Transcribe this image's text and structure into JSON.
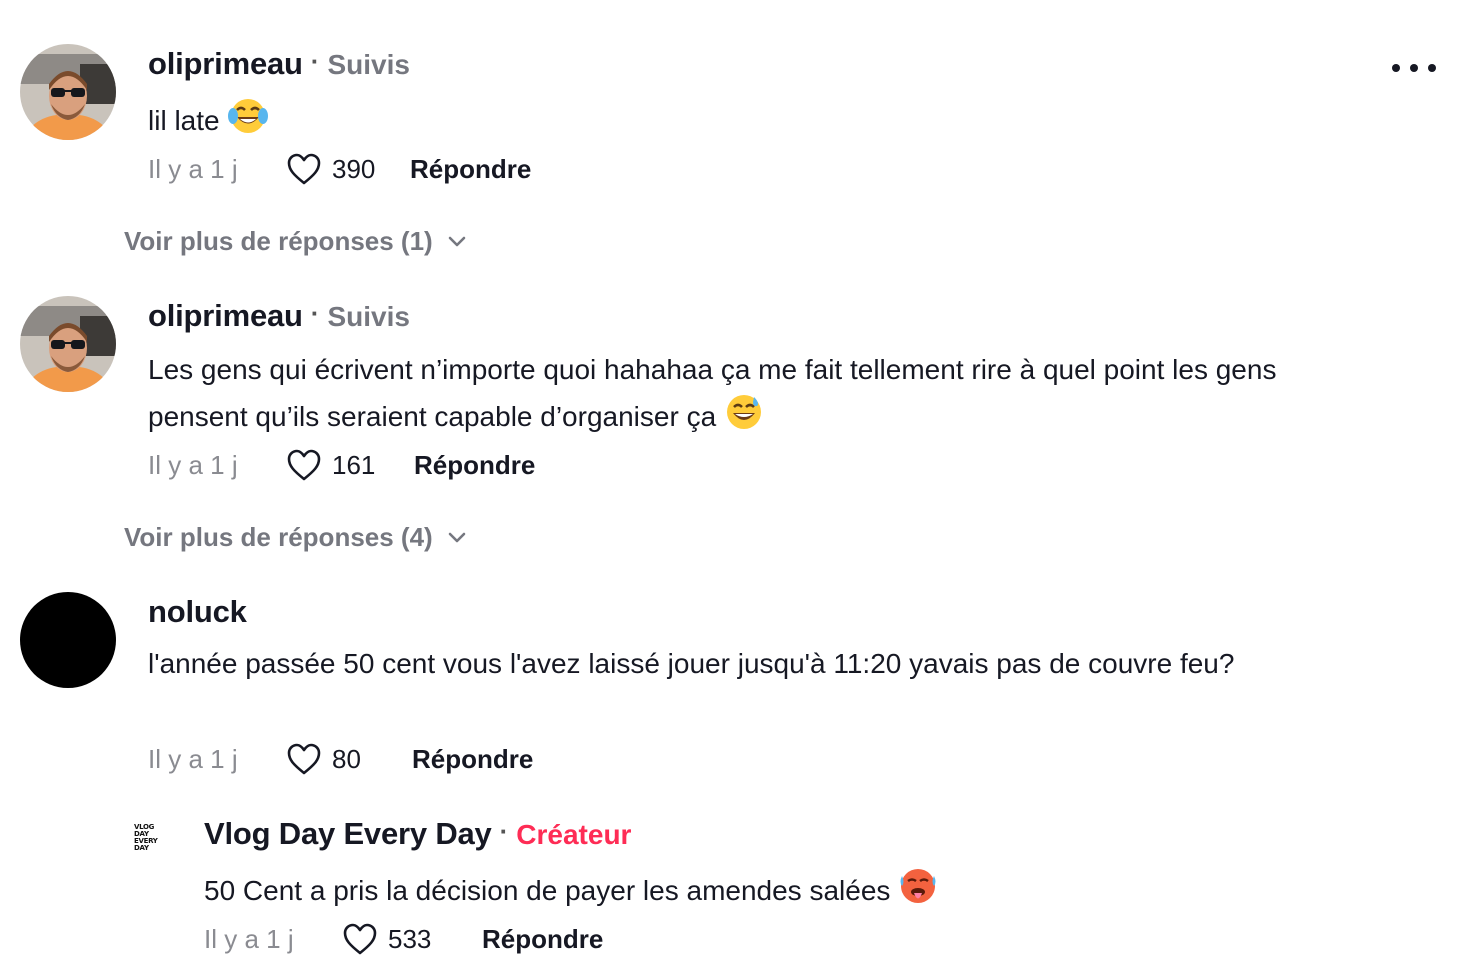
{
  "comments": [
    {
      "username": "oliprimeau",
      "badge": "Suivis",
      "text": "lil late",
      "emoji": "joy",
      "time": "Il y a 1 j",
      "likes": "390",
      "reply_label": "Répondre",
      "more_replies": "Voir plus de réponses (1)"
    },
    {
      "username": "oliprimeau",
      "badge": "Suivis",
      "text": "Les gens qui écrivent n’importe quoi hahahaa ça me fait tellement rire à quel point les gens pensent qu’ils seraient capable d’organiser ça",
      "emoji": "grinning-sweat",
      "time": "Il y a 1 j",
      "likes": "161",
      "reply_label": "Répondre",
      "more_replies": "Voir plus de réponses (4)"
    },
    {
      "username": "noluck",
      "text": "l'année passée 50 cent vous l'avez laissé jouer jusqu'à 11:20 yavais pas de couvre feu?",
      "time": "Il y a 1 j",
      "likes": "80",
      "reply_label": "Répondre"
    },
    {
      "username": "Vlog Day Every Day",
      "badge": "Créateur",
      "avatar_text": [
        "VLOG",
        "DAY",
        "EVERY",
        "DAY"
      ],
      "text": "50 Cent a pris la décision de payer les amendes salées",
      "emoji": "hot-face",
      "time": "Il y a 1 j",
      "likes": "533",
      "reply_label": "Répondre"
    }
  ],
  "colors": {
    "text": "#161823",
    "muted": "#8a8b91",
    "badge": "#75777f",
    "creator": "#fe2c55"
  },
  "icons": [
    "more-horizontal-icon",
    "heart-outline-icon",
    "chevron-down-icon"
  ]
}
